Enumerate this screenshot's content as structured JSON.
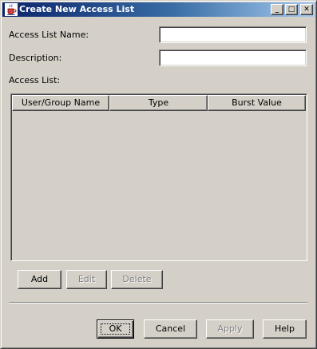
{
  "window": {
    "title": "Create New Access List",
    "icon": "java-cup-icon",
    "controls": {
      "minimize": "_",
      "maximize": "□",
      "close": "✕"
    }
  },
  "form": {
    "access_list_name_label": "Access List Name:",
    "access_list_name_value": "",
    "description_label": "Description:",
    "description_value": "",
    "access_list_label": "Access List:"
  },
  "table": {
    "columns": [
      "User/Group Name",
      "Type",
      "Burst Value"
    ],
    "rows": []
  },
  "table_buttons": {
    "add": "Add",
    "edit": "Edit",
    "delete": "Delete"
  },
  "dialog_buttons": {
    "ok": "OK",
    "cancel": "Cancel",
    "apply": "Apply",
    "help": "Help"
  }
}
